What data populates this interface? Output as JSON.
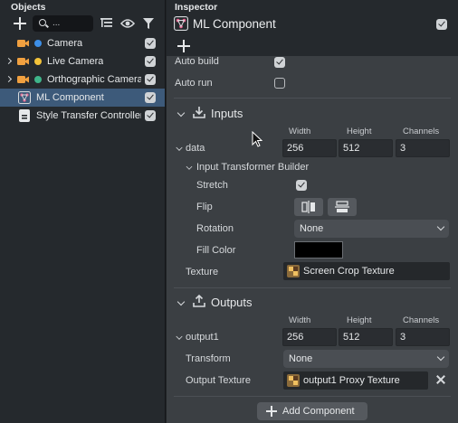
{
  "objects_panel": {
    "title": "Objects",
    "search": {
      "value": "..."
    },
    "items": [
      {
        "label": "Camera",
        "dot_color": "#3d8fe8",
        "has_arrow": false,
        "enabled": true
      },
      {
        "label": "Live Camera",
        "dot_color": "#f2c23a",
        "has_arrow": true,
        "enabled": true
      },
      {
        "label": "Orthographic Camera",
        "dot_color": "#3fb58a",
        "has_arrow": true,
        "enabled": true
      },
      {
        "label": "ML Component",
        "selected": true,
        "enabled": true
      },
      {
        "label": "Style Transfer Controller",
        "enabled": true
      }
    ],
    "camera_icon_color": "#f0a040"
  },
  "inspector": {
    "title": "Inspector",
    "component_name": "ML Component",
    "component_enabled": true,
    "auto_build": {
      "label": "Auto build",
      "checked": true
    },
    "auto_run": {
      "label": "Auto run",
      "checked": false
    },
    "inputs": {
      "title": "Inputs",
      "col_width": "Width",
      "col_height": "Height",
      "col_channels": "Channels",
      "name": "data",
      "width": "256",
      "height": "512",
      "channels": "3",
      "transformer": {
        "title": "Input Transformer Builder",
        "stretch_label": "Stretch",
        "stretch_checked": true,
        "flip_label": "Flip",
        "rotation_label": "Rotation",
        "rotation_value": "None",
        "fill_color_label": "Fill Color",
        "fill_color": "#000000"
      },
      "texture_label": "Texture",
      "texture_value": "Screen Crop Texture"
    },
    "outputs": {
      "title": "Outputs",
      "col_width": "Width",
      "col_height": "Height",
      "col_channels": "Channels",
      "name": "output1",
      "width": "256",
      "height": "512",
      "channels": "3",
      "transform_label": "Transform",
      "transform_value": "None",
      "output_texture_label": "Output Texture",
      "output_texture_value": "output1 Proxy Texture"
    },
    "add_component_label": "Add Component"
  }
}
